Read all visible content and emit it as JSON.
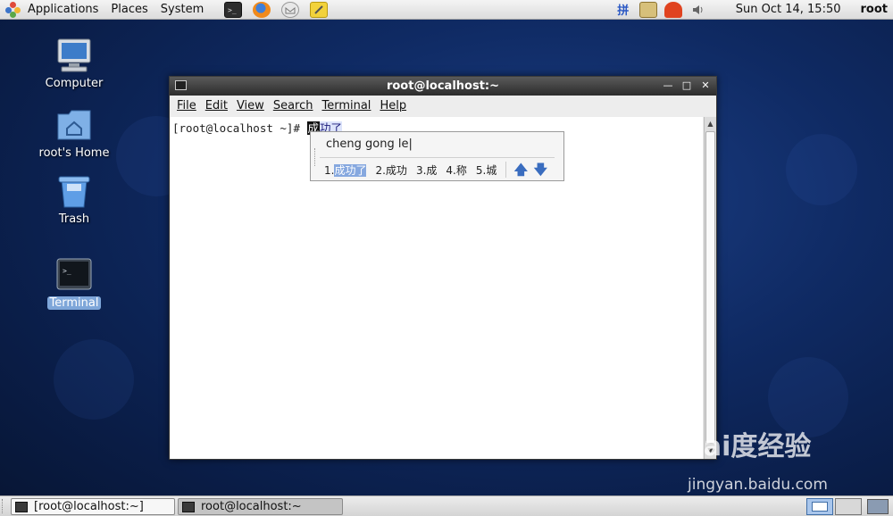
{
  "top_panel": {
    "menus": [
      "Applications",
      "Places",
      "System"
    ],
    "launchers": [
      "terminal-launcher-icon",
      "firefox-icon",
      "mail-icon",
      "notes-icon"
    ],
    "tray": [
      "input-method-icon",
      "network-icon",
      "alert-icon",
      "volume-icon"
    ],
    "input_method_glyph": "拼",
    "clock": "Sun Oct 14, 15:50",
    "user": "root"
  },
  "desktop": {
    "icons": [
      {
        "label": "Computer",
        "icon": "computer-icon"
      },
      {
        "label": "root's Home",
        "icon": "home-folder-icon"
      },
      {
        "label": "Trash",
        "icon": "trash-icon"
      },
      {
        "label": "Terminal",
        "icon": "terminal-icon"
      }
    ]
  },
  "terminal": {
    "title": "root@localhost:~",
    "menu": [
      "File",
      "Edit",
      "View",
      "Search",
      "Terminal",
      "Help"
    ],
    "prompt": "[root@localhost ~]# ",
    "preedit_cursor_char": "成",
    "preedit_rest": "功了"
  },
  "ime": {
    "pinyin": "cheng gong le|",
    "candidates": [
      {
        "num": "1.",
        "word": "成功了"
      },
      {
        "num": "2.",
        "word": "成功"
      },
      {
        "num": "3.",
        "word": "成"
      },
      {
        "num": "4.",
        "word": "称"
      },
      {
        "num": "5.",
        "word": "城"
      }
    ],
    "selected_index": 0
  },
  "taskbar": {
    "items": [
      "[root@localhost:~]",
      "root@localhost:~"
    ],
    "active_index": 1
  },
  "watermark": {
    "logo": "Bai度经验",
    "url": "jingyan.baidu.com"
  },
  "colors": {
    "desktop_bg": "#0f2a63",
    "selection": "#7ea6d9",
    "candidate_highlight": "#86a8df",
    "titlebar": "#3c3c3c"
  }
}
